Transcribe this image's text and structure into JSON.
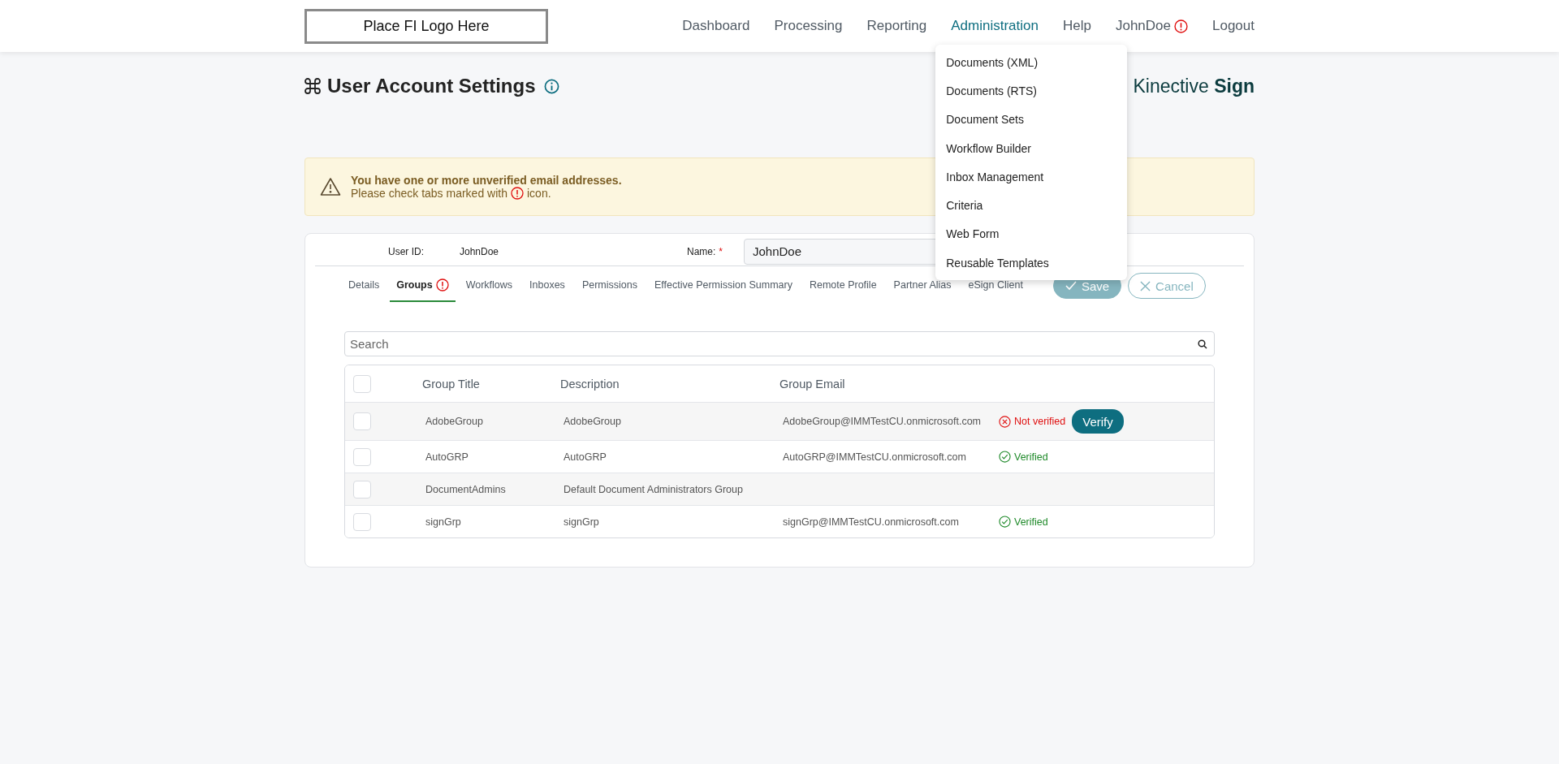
{
  "header": {
    "logo": "Place FI Logo Here",
    "nav": [
      {
        "label": "Dashboard",
        "selected": false,
        "alert": false
      },
      {
        "label": "Processing",
        "selected": false,
        "alert": false
      },
      {
        "label": "Reporting",
        "selected": false,
        "alert": false
      },
      {
        "label": "Administration",
        "selected": true,
        "alert": false,
        "menu": [
          "Documents (XML)",
          "Documents (RTS)",
          "Document Sets",
          "Workflow Builder",
          "Inbox Management",
          "Criteria",
          "Web Form",
          "Reusable Templates"
        ]
      },
      {
        "label": "Help",
        "selected": false,
        "alert": false
      },
      {
        "label": "JohnDoe",
        "selected": false,
        "alert": true
      },
      {
        "label": "Logout",
        "selected": false,
        "alert": false
      }
    ]
  },
  "page": {
    "title": "User Account Settings",
    "brand": "Kinective **Sign**"
  },
  "alert": {
    "title": "You have one or more unverified email addresses.",
    "text_before": "Please check tabs marked with",
    "text_after": "icon."
  },
  "user": {
    "id_label": "User ID:",
    "id_value": "JohnDoe",
    "name_label": "Name:",
    "required_mark": "*",
    "name_value": "JohnDoe"
  },
  "tabs": [
    {
      "label": "Details",
      "selected": false,
      "alert": false
    },
    {
      "label": "Groups",
      "selected": true,
      "alert": true
    },
    {
      "label": "Workflows",
      "selected": false,
      "alert": false
    },
    {
      "label": "Inboxes",
      "selected": false,
      "alert": false
    },
    {
      "label": "Permissions",
      "selected": false,
      "alert": false
    },
    {
      "label": "Effective Permission Summary",
      "selected": false,
      "alert": false
    },
    {
      "label": "Remote Profile",
      "selected": false,
      "alert": false
    },
    {
      "label": "Partner Alias",
      "selected": false,
      "alert": false
    },
    {
      "label": "eSign Client",
      "selected": false,
      "alert": false
    }
  ],
  "buttons": [
    {
      "kind": "save",
      "label": "Save",
      "disabled": true
    },
    {
      "kind": "cancel",
      "label": "Cancel",
      "disabled": true
    }
  ],
  "search": {
    "placeholder": "Search"
  },
  "table": {
    "select_all_checked": false,
    "columns": [
      "Group Title",
      "Description",
      "Group Email"
    ],
    "rows": [
      {
        "checked": false,
        "title": "AdobeGroup",
        "description": "AdobeGroup",
        "email": "AdobeGroup@IMMTestCU.onmicrosoft.com",
        "status": {
          "kind": "unverified",
          "label": "Not verified",
          "action": "Verify"
        }
      },
      {
        "checked": false,
        "title": "AutoGRP",
        "description": "AutoGRP",
        "email": "AutoGRP@IMMTestCU.onmicrosoft.com",
        "status": {
          "kind": "verified",
          "label": "Verified"
        }
      },
      {
        "checked": false,
        "title": "DocumentAdmins",
        "description": "Default Document Administrators Group"
      },
      {
        "checked": false,
        "title": "signGrp",
        "description": "signGrp",
        "email": "signGrp@IMMTestCU.onmicrosoft.com",
        "status": {
          "kind": "verified",
          "label": "Verified"
        }
      }
    ]
  }
}
